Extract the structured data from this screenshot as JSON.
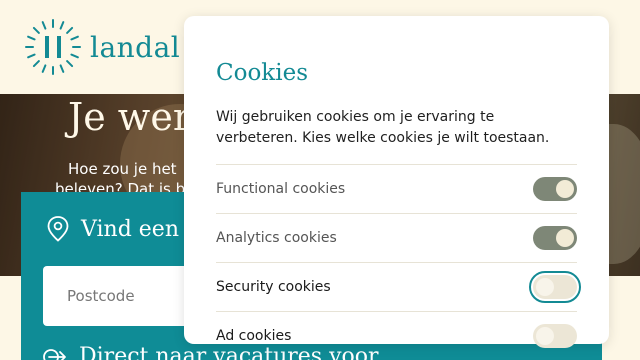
{
  "header": {
    "logo_text": "landal"
  },
  "hero": {
    "title": "Je wer",
    "subtitle_line1": "Hoe zou je het",
    "subtitle_line2": "beleven? Dat is b"
  },
  "search": {
    "title": "Vind een p",
    "postcode_placeholder": "Postcode",
    "direct_text": "Direct naar vacatures voor"
  },
  "cookie_modal": {
    "title": "Cookies",
    "description": "Wij gebruiken cookies om je ervaring te verbeteren. Kies welke cookies je wilt toestaan.",
    "options": [
      {
        "label": "Functional cookies",
        "enabled": true
      },
      {
        "label": "Analytics cookies",
        "enabled": true
      },
      {
        "label": "Security cookies",
        "enabled": false,
        "focused": true
      },
      {
        "label": "Ad cookies",
        "enabled": false
      }
    ]
  },
  "colors": {
    "brand_teal": "#138a94",
    "background": "#fdf7e6",
    "toggle_on": "#7e8777",
    "toggle_off": "#ece6d6"
  },
  "icons": {
    "logo": "landal-logo-icon",
    "pin": "map-pin-icon",
    "arrow": "arrow-right-icon"
  }
}
